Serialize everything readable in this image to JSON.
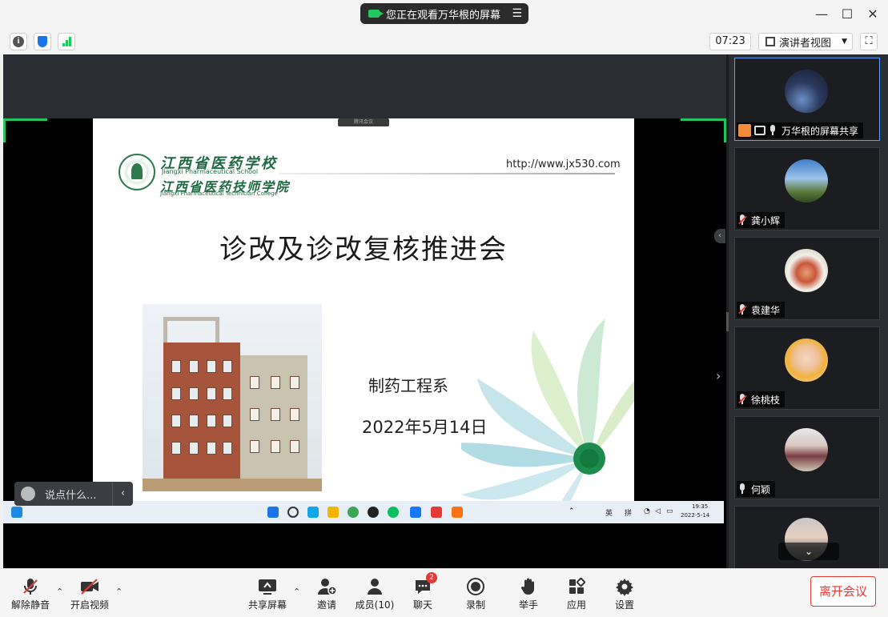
{
  "window": {
    "share_banner": "您正在观看万华根的屏幕",
    "minimize": "—",
    "maximize": "☐",
    "close": "✕"
  },
  "toolbar_top": {
    "info_icon": "i",
    "timer": "07:23",
    "view_mode": "演讲者视图",
    "fullscreen": "⛶"
  },
  "slide": {
    "tag": "腾讯会议",
    "school_cn": "江西省医药学校",
    "school_en": "Jiangxi Pharmaceutical School",
    "college_cn": "江西省医药技师学院",
    "college_en": "Jiangxi Pharmaceutical Technician College",
    "url": "http://www.jx530.com",
    "title": "诊改及诊改复核推进会",
    "department": "制药工程系",
    "date": "2022年5月14日"
  },
  "share_taskbar": {
    "ime_lang": "英",
    "ime_mode": "拼",
    "clock_time": "19:35",
    "clock_date": "2022-5-14"
  },
  "chat": {
    "placeholder": "说点什么..."
  },
  "participants": [
    {
      "name": "万华根的屏幕共享",
      "muted": false,
      "sharing": true,
      "accent": "#f08c3a"
    },
    {
      "name": "龚小辉",
      "muted": true,
      "sharing": false
    },
    {
      "name": "袁建华",
      "muted": true,
      "sharing": false
    },
    {
      "name": "徐桃枝",
      "muted": true,
      "sharing": false
    },
    {
      "name": "何颖",
      "muted": false,
      "sharing": false
    }
  ],
  "bottom": {
    "unmute": "解除静音",
    "video": "开启视频",
    "share": "共享屏幕",
    "invite": "邀请",
    "members": "成员(10)",
    "chat": "聊天",
    "chat_badge": "2",
    "record": "录制",
    "raise_hand": "举手",
    "apps": "应用",
    "settings": "设置",
    "leave": "离开会议"
  },
  "colors": {
    "accent_green": "#22c55e",
    "leave_red": "#e53935",
    "panel_dark": "#2a2d31"
  }
}
